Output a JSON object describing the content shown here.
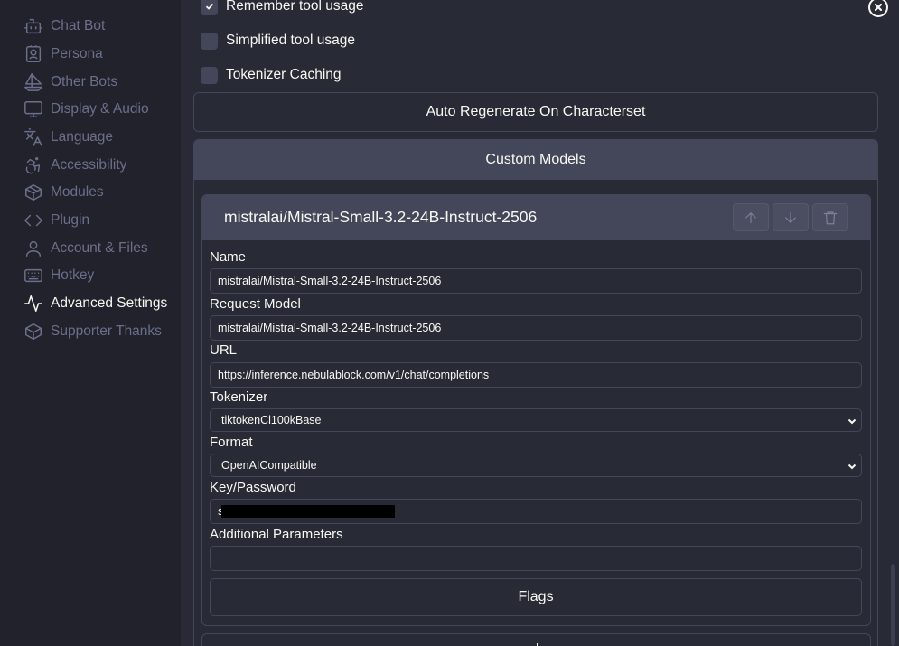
{
  "sidebar": {
    "items": [
      {
        "label": "Chat Bot",
        "icon": "bot-icon"
      },
      {
        "label": "Persona",
        "icon": "contact-icon"
      },
      {
        "label": "Other Bots",
        "icon": "sailboat-icon"
      },
      {
        "label": "Display & Audio",
        "icon": "monitor-icon"
      },
      {
        "label": "Language",
        "icon": "languages-icon"
      },
      {
        "label": "Accessibility",
        "icon": "accessibility-icon"
      },
      {
        "label": "Modules",
        "icon": "package-icon"
      },
      {
        "label": "Plugin",
        "icon": "code-icon"
      },
      {
        "label": "Account & Files",
        "icon": "user-icon"
      },
      {
        "label": "Hotkey",
        "icon": "keyboard-icon"
      },
      {
        "label": "Advanced Settings",
        "icon": "activity-icon",
        "active": true
      },
      {
        "label": "Supporter Thanks",
        "icon": "box-icon"
      }
    ]
  },
  "toggles": {
    "remember_tool_usage": {
      "label": "Remember tool usage",
      "checked": true
    },
    "simplified_tool_usage": {
      "label": "Simplified tool usage",
      "checked": false
    },
    "tokenizer_caching": {
      "label": "Tokenizer Caching",
      "checked": false
    }
  },
  "buttons": {
    "auto_regenerate": "Auto Regenerate On Characterset",
    "flags": "Flags"
  },
  "custom_models": {
    "header": "Custom Models",
    "model": {
      "title": "mistralai/Mistral-Small-3.2-24B-Instruct-2506",
      "name_label": "Name",
      "name_value": "mistralai/Mistral-Small-3.2-24B-Instruct-2506",
      "request_model_label": "Request Model",
      "request_model_value": "mistralai/Mistral-Small-3.2-24B-Instruct-2506",
      "url_label": "URL",
      "url_value": "https://inference.nebulablock.com/v1/chat/completions",
      "tokenizer_label": "Tokenizer",
      "tokenizer_value": "tiktokenCl100kBase",
      "format_label": "Format",
      "format_value": "OpenAICompatible",
      "key_label": "Key/Password",
      "key_value": "s",
      "additional_params_label": "Additional Parameters",
      "additional_params_value": ""
    }
  },
  "colors": {
    "background": "#282a36",
    "sidebar": "#21222c",
    "panel_header": "#44475a",
    "text": "#f8f8f2",
    "muted": "#6b7089"
  }
}
